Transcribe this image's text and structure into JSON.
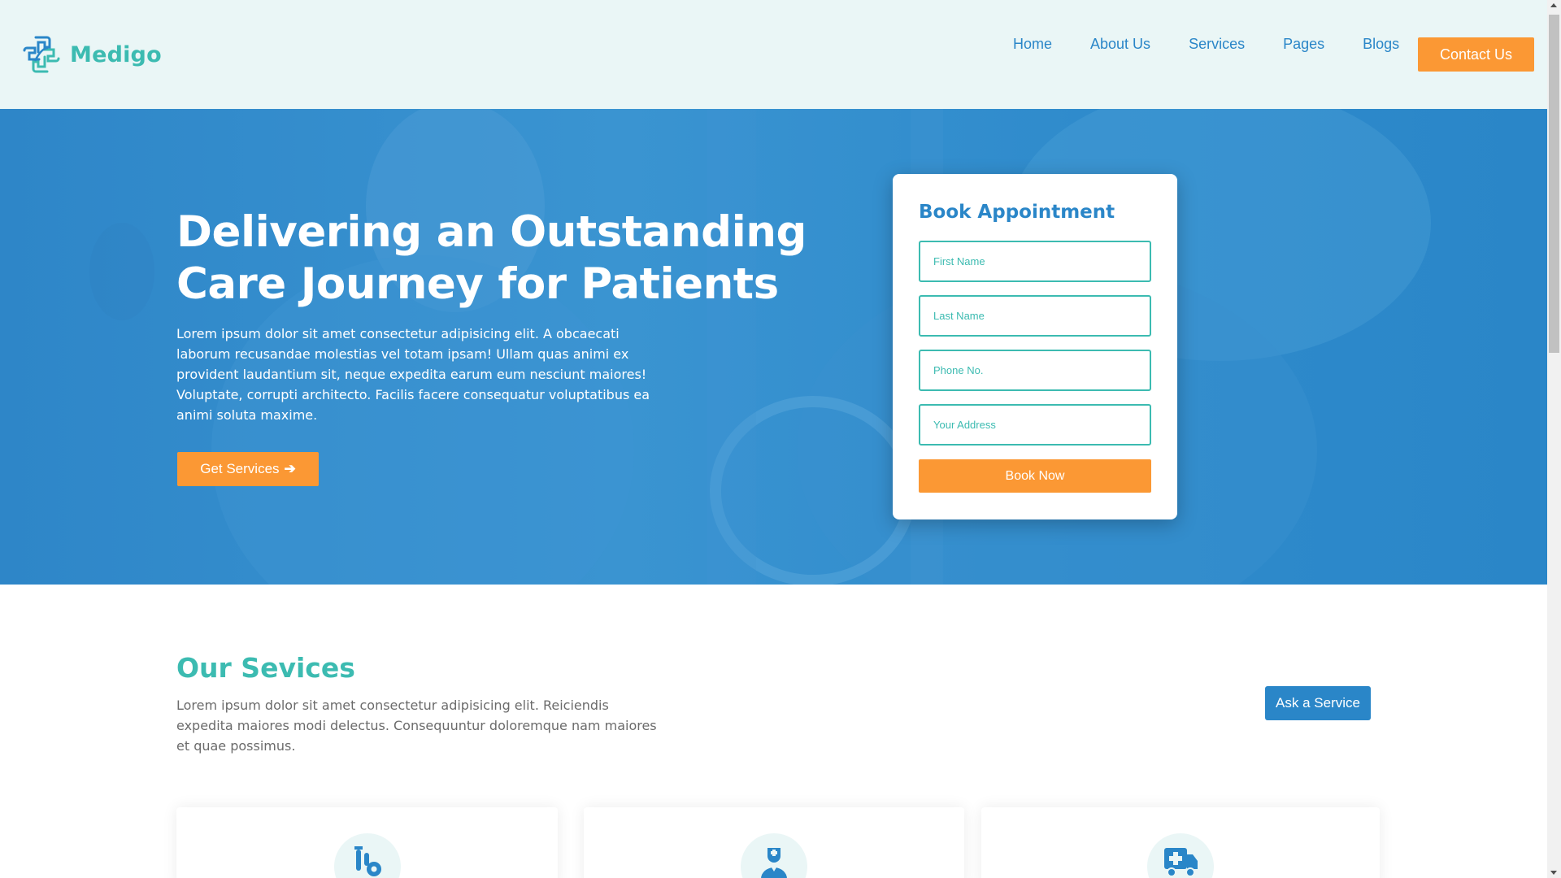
{
  "header": {
    "logo_text": "Medigo",
    "nav": [
      "Home",
      "About Us",
      "Services",
      "Pages",
      "Blogs"
    ],
    "contact_label": "Contact Us"
  },
  "hero": {
    "title_line1": "Delivering an Outstanding",
    "title_line2": "Care Journey for Patients",
    "text": "Lorem ipsum dolor sit amet consectetur adipisicing elit. A obcaecati laborum recusandae molestias vel totam ipsam! Ullam quas animi ex provident laudantium sit, neque expedita earum eum nesciunt maiores! Voluptate, corrupti architecto. Facilis facere consequatur voluptatibus ea animi soluta maxime.",
    "button_label": "Get Services",
    "button_arrow": "➔"
  },
  "appointment": {
    "title": "Book Appointment",
    "fields": {
      "first_name": "First Name",
      "last_name": "Last Name",
      "phone": "Phone No.",
      "address": "Your Address"
    },
    "submit_label": "Book Now"
  },
  "services": {
    "title": "Our Sevices",
    "text": "Lorem ipsum dolor sit amet consectetur adipisicing elit. Reiciendis expedita maiores modi delectus. Consequuntur doloremque nam maiores et quae possimus.",
    "ask_label": "Ask a Service",
    "cards": [
      {
        "icon": "lab-gear-icon"
      },
      {
        "icon": "doctor-icon"
      },
      {
        "icon": "ambulance-icon"
      }
    ]
  },
  "colors": {
    "primary_blue": "#2a86c8",
    "teal": "#3cbbb1",
    "orange": "#fb9834",
    "header_bg": "#eaf6f6"
  }
}
